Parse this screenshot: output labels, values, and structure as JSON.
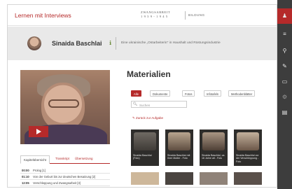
{
  "topbar": {
    "brand": "Lernen mit Interviews",
    "partner_line1": "ZWANGSARBEIT",
    "partner_line2": "1 9 3 9 - 1 9 4 5",
    "partner_tag": "BILDUNG"
  },
  "header": {
    "person_name": "Sinaida Baschlai",
    "person_desc": "Eine ukrainische „Ostarbeiterin\" in Haushalt und Rüstungsindustrie"
  },
  "video": {
    "tabs": [
      "Kapitelübersicht",
      "Transkript",
      "Übersetzung"
    ],
    "chapters": [
      {
        "time": "00:00",
        "text": "Prolog [1]"
      },
      {
        "time": "01:10",
        "text": "Von der Geburt bis zur deutschen Besatzung [2]"
      },
      {
        "time": "12:05",
        "text": "Verschleppung und Zwangsarbeit [3]"
      }
    ]
  },
  "materials": {
    "title": "Materialien",
    "filters": [
      "Alle",
      "Dokumente",
      "Fotos",
      "Infotafeln",
      "Methodenblätter"
    ],
    "search_placeholder": "Suchen",
    "back_link": "Zurück zur Aufgabe",
    "tiles": [
      {
        "caption": "Sinaida Baschlai (Foto)"
      },
      {
        "caption": "Sinaida Baschlai mit ihrer Mutter - Foto"
      },
      {
        "caption": "Sinaida Baschlai, ca. 16 Jahre alt - Foto"
      },
      {
        "caption": "Sinaida Baschlai vor der Verschleppung - Foto"
      }
    ]
  },
  "rail": {
    "icons": [
      "user-icon",
      "menu-icon",
      "map-pin-icon",
      "edit-icon",
      "folder-icon",
      "gear-icon",
      "book-icon"
    ]
  },
  "colors": {
    "accent": "#b52a2a",
    "rail": "#3d3d3d",
    "band": "#e9e9e9"
  }
}
